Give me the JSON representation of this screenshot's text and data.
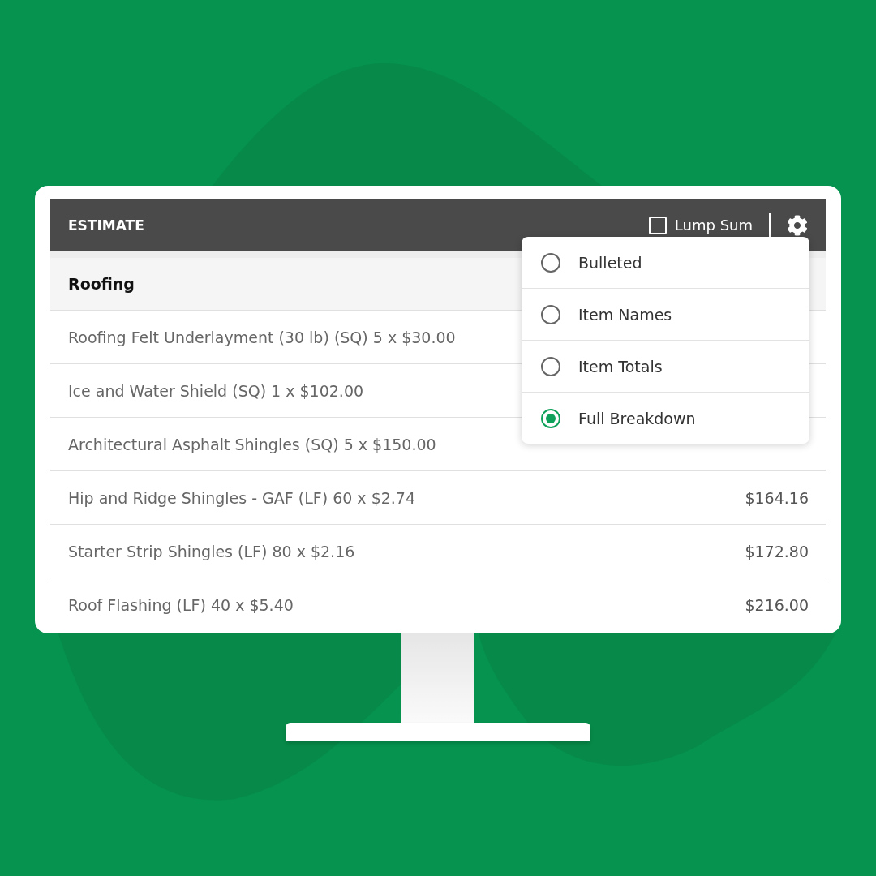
{
  "header": {
    "title": "ESTIMATE",
    "lump_sum": {
      "label": "Lump Sum",
      "checked": false
    }
  },
  "section": {
    "title": "Roofing"
  },
  "items": [
    {
      "description": "Roofing Felt Underlayment (30 lb) (SQ) 5 x $30.00"
    },
    {
      "description": "Ice and Water Shield (SQ) 1 x $102.00"
    },
    {
      "description": "Architectural Asphalt Shingles (SQ) 5 x $150.00"
    },
    {
      "description": "Hip and Ridge Shingles - GAF (LF) 60 x $2.74",
      "price": "$164.16"
    },
    {
      "description": "Starter Strip Shingles (LF) 80 x $2.16",
      "price": "$172.80"
    },
    {
      "description": "Roof Flashing (LF) 40 x $5.40",
      "price": "$216.00"
    }
  ],
  "settings_menu": {
    "options": [
      {
        "label": "Bulleted",
        "selected": false
      },
      {
        "label": "Item Names",
        "selected": false
      },
      {
        "label": "Item Totals",
        "selected": false
      },
      {
        "label": "Full Breakdown",
        "selected": true
      }
    ]
  }
}
